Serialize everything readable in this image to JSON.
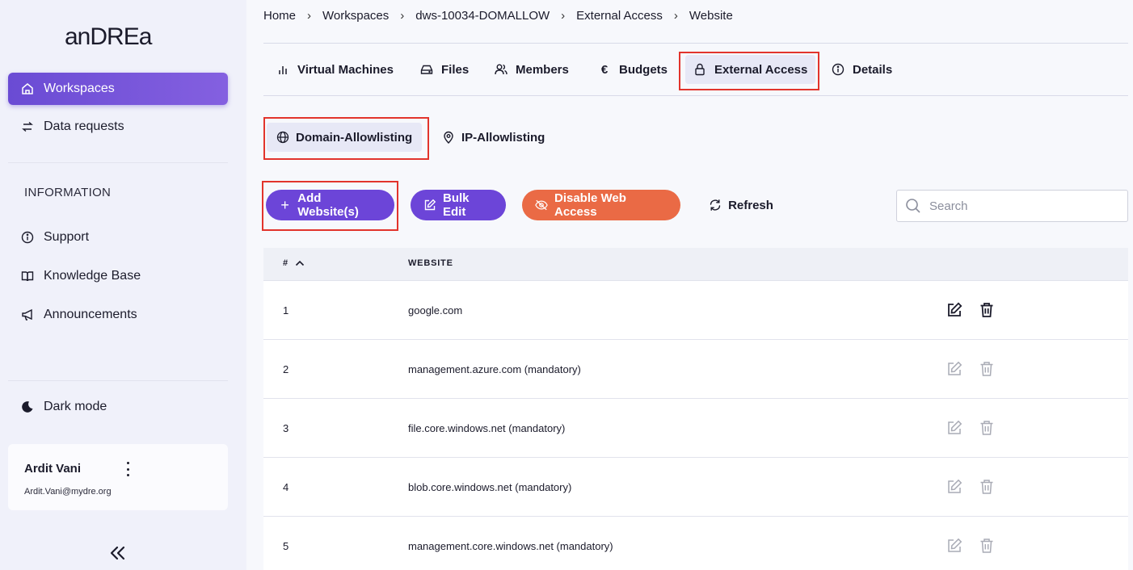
{
  "sidebar": {
    "logo_text": "anDREa",
    "nav": [
      {
        "label": "Workspaces",
        "icon": "home-icon",
        "active": true
      },
      {
        "label": "Data requests",
        "icon": "swap-arrows-icon"
      }
    ],
    "section_label": "INFORMATION",
    "info_items": [
      {
        "label": "Support",
        "icon": "info-circle-icon"
      },
      {
        "label": "Knowledge Base",
        "icon": "book-icon"
      },
      {
        "label": "Announcements",
        "icon": "megaphone-icon"
      }
    ],
    "dark_mode_label": "Dark mode",
    "user": {
      "name": "Ardit Vani",
      "email": "Ardit.Vani@mydre.org"
    }
  },
  "breadcrumb": [
    "Home",
    "Workspaces",
    "dws-10034-DOMALLOW",
    "External Access",
    "Website"
  ],
  "tabs": [
    {
      "label": "Virtual Machines",
      "icon": "bar-chart-icon"
    },
    {
      "label": "Files",
      "icon": "hard-drive-icon"
    },
    {
      "label": "Members",
      "icon": "users-icon"
    },
    {
      "label": "Budgets",
      "icon": "euro-icon"
    },
    {
      "label": "External Access",
      "icon": "lock-icon",
      "active": true
    },
    {
      "label": "Details",
      "icon": "info-circle-icon"
    }
  ],
  "subtabs": [
    {
      "label": "Domain-Allowlisting",
      "icon": "globe-icon",
      "active": true
    },
    {
      "label": "IP-Allowlisting",
      "icon": "map-pin-icon"
    }
  ],
  "actions": {
    "add": "Add Website(s)",
    "bulk_edit": "Bulk Edit",
    "disable": "Disable Web Access",
    "refresh": "Refresh"
  },
  "search": {
    "placeholder": "Search",
    "value": ""
  },
  "table": {
    "headers": {
      "num": "#",
      "website": "WEBSITE"
    },
    "rows": [
      {
        "num": "1",
        "website": "google.com",
        "editable": true
      },
      {
        "num": "2",
        "website": "management.azure.com (mandatory)",
        "editable": false
      },
      {
        "num": "3",
        "website": "file.core.windows.net (mandatory)",
        "editable": false
      },
      {
        "num": "4",
        "website": "blob.core.windows.net (mandatory)",
        "editable": false
      },
      {
        "num": "5",
        "website": "management.core.windows.net (mandatory)",
        "editable": false
      }
    ]
  },
  "colors": {
    "accent": "#6c45d8",
    "danger": "#ea6a45",
    "highlight": "#e2342c"
  }
}
